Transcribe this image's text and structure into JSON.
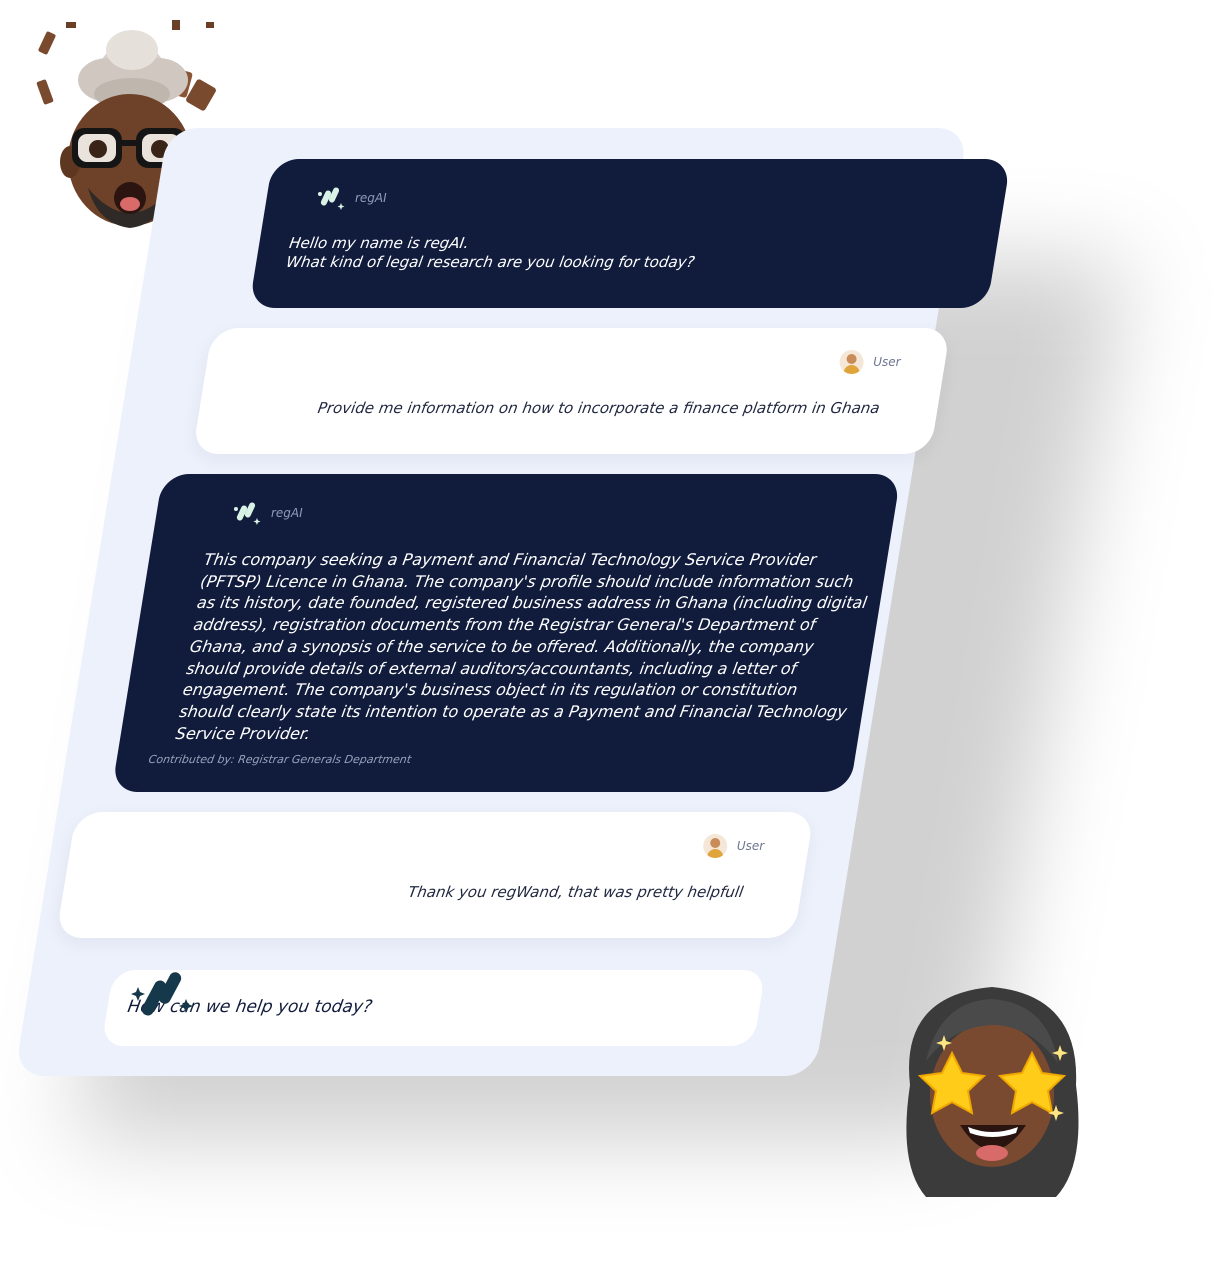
{
  "chat": {
    "messages": [
      {
        "role": "bot",
        "speaker": "regAI",
        "text": "Hello my name is regAI.\nWhat kind of legal research are you looking for today?"
      },
      {
        "role": "user",
        "speaker": "User",
        "text": "Provide me information on how to incorporate a finance platform in Ghana"
      },
      {
        "role": "bot",
        "speaker": "regAI",
        "text": "This company seeking a Payment and Financial Technology Service Provider\n(PFTSP) Licence in Ghana. The company's profile should include information such\nas its history, date founded, registered business address in Ghana (including digital\naddress), registration documents from the Registrar General's Department of\nGhana, and a synopsis of the service to be offered. Additionally, the company\nshould provide details of external auditors/accountants, including a letter of\nengagement. The company's business object in its regulation or constitution\nshould clearly state its intention to operate as a Payment and Financial Technology\nService Provider.",
        "contributed_by": "Contributed by: Registrar Generals Department"
      },
      {
        "role": "user",
        "speaker": "User",
        "text": "Thank you regWand, that was pretty helpfull"
      }
    ],
    "input": {
      "placeholder": "How can we help you today?"
    }
  },
  "colors": {
    "bot_bubble": "#111c3d",
    "user_bubble": "#ffffff",
    "card_background": "#edf1fb",
    "logo_accent": "#1c4a5a",
    "logo_light": "#d8f3e6"
  },
  "icons": {
    "bot_logo": "regai-logo-icon",
    "user_avatar": "user-avatar-icon",
    "decor_left": "mind-blown-memoji",
    "decor_right": "star-eyes-memoji"
  }
}
